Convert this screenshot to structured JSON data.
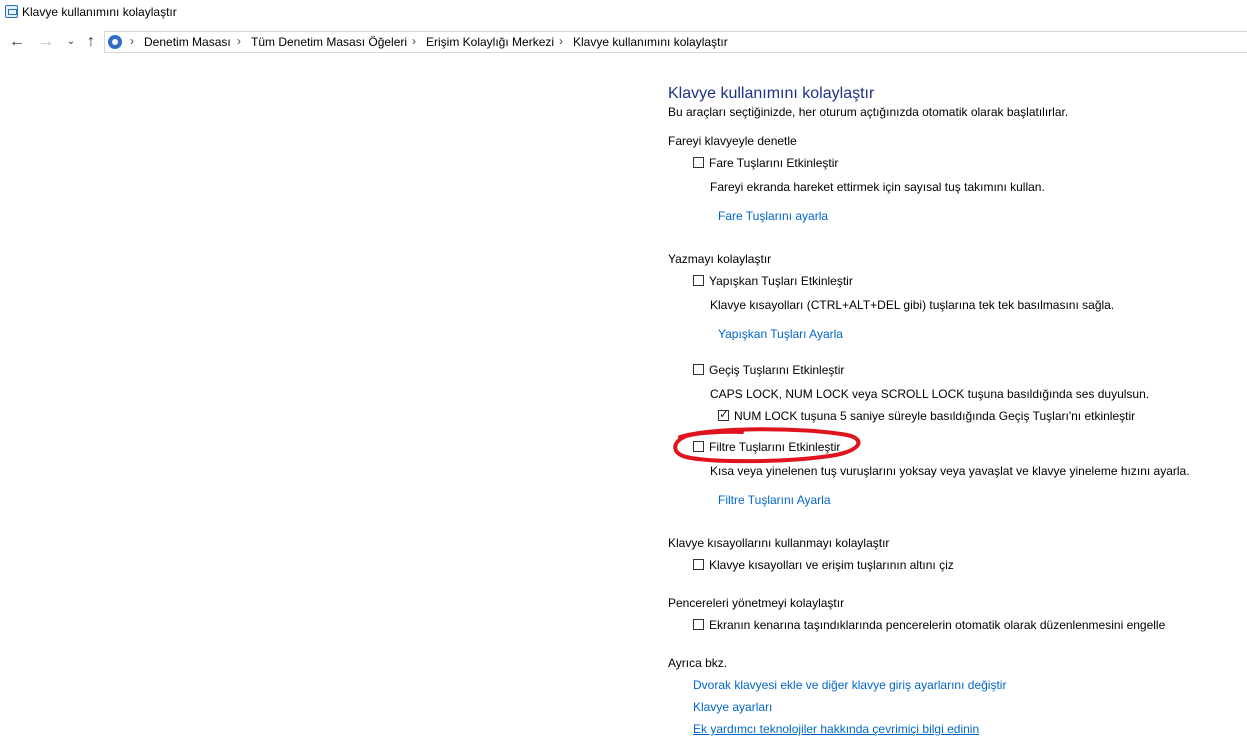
{
  "window": {
    "title": "Klavye kullanımını kolaylaştır"
  },
  "breadcrumb": {
    "items": [
      "Denetim Masası",
      "Tüm Denetim Masası Öğeleri",
      "Erişim Kolaylığı Merkezi",
      "Klavye kullanımını kolaylaştır"
    ],
    "separator": "›"
  },
  "page": {
    "title": "Klavye kullanımını kolaylaştır",
    "subtitle": "Bu araçları seçtiğinizde, her oturum açtığınızda otomatik olarak başlatılırlar."
  },
  "sections": {
    "mouse": {
      "title": "Fareyi klavyeyle denetle",
      "mouse_keys": {
        "label": "Fare Tuşlarını Etkinleştir",
        "checked": false,
        "description": "Fareyi ekranda hareket ettirmek için sayısal tuş takımını kullan.",
        "link": "Fare Tuşlarını ayarla"
      }
    },
    "typing": {
      "title": "Yazmayı kolaylaştır",
      "sticky_keys": {
        "label": "Yapışkan Tuşları Etkinleştir",
        "checked": false,
        "description": "Klavye kısayolları (CTRL+ALT+DEL gibi) tuşlarına tek tek basılmasını sağla.",
        "link": "Yapışkan Tuşları Ayarla"
      },
      "toggle_keys": {
        "label": "Geçiş Tuşlarını Etkinleştir",
        "checked": false,
        "description": "CAPS LOCK, NUM LOCK veya SCROLL LOCK tuşuna basıldığında ses duyulsun.",
        "sub_option": {
          "label": "NUM LOCK tuşuna 5 saniye süreyle basıldığında Geçiş Tuşları'nı etkinleştir",
          "checked": true
        }
      },
      "filter_keys": {
        "label": "Filtre Tuşlarını Etkinleştir",
        "checked": false,
        "description": "Kısa veya yinelenen tuş vuruşlarını yoksay veya yavaşlat ve klavye yineleme hızını ayarla.",
        "link": "Filtre Tuşlarını Ayarla"
      }
    },
    "shortcuts": {
      "title": "Klavye kısayollarını kullanmayı kolaylaştır",
      "underline": {
        "label": "Klavye kısayolları ve erişim tuşlarının altını çiz",
        "checked": false
      }
    },
    "windows": {
      "title": "Pencereleri yönetmeyi kolaylaştır",
      "snap": {
        "label": "Ekranın kenarına taşındıklarında pencerelerin otomatik olarak düzenlenmesini engelle",
        "checked": false
      }
    },
    "see_also": {
      "title": "Ayrıca bkz.",
      "links": [
        "Dvorak klavyesi ekle ve diğer klavye giriş ayarlarını değiştir",
        "Klavye ayarları",
        "Ek yardımcı teknolojiler hakkında çevrimiçi bilgi edinin"
      ]
    }
  },
  "colors": {
    "heading": "#1e3287",
    "link": "#0066cc",
    "annotation": "#e0141e"
  }
}
